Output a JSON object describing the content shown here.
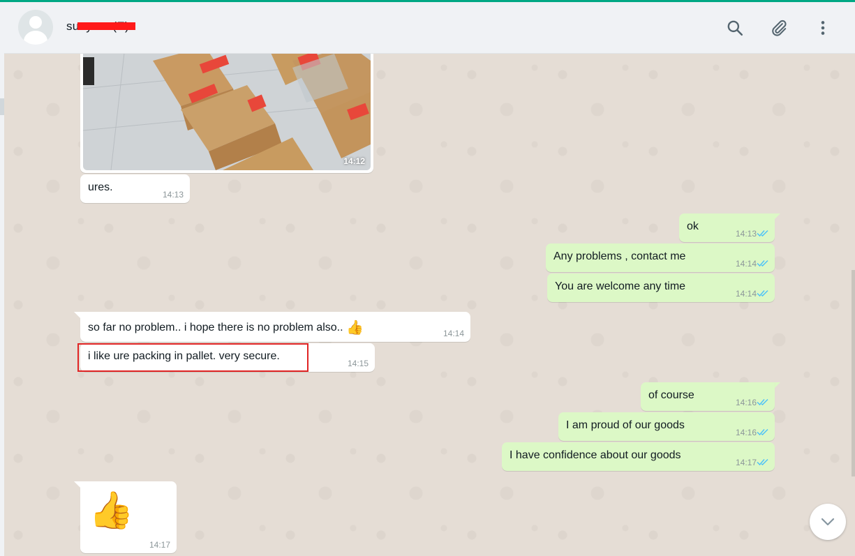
{
  "header": {
    "contact_name": "sunyuan(E)",
    "icons": [
      "search-icon",
      "attach-icon",
      "menu-icon"
    ]
  },
  "colors": {
    "incoming_bubble": "#ffffff",
    "outgoing_bubble": "#dcf8c6",
    "read_ticks": "#4fc3f7",
    "chat_background": "#e5ddd5",
    "highlight_box": "#e02424"
  },
  "messages": [
    {
      "dir": "in",
      "type": "image",
      "time": "14:12"
    },
    {
      "dir": "in",
      "text": "ures.",
      "time": "14:13"
    },
    {
      "dir": "out",
      "text": "ok",
      "time": "14:13",
      "status": "read"
    },
    {
      "dir": "out",
      "text": "Any problems , contact me",
      "time": "14:14",
      "status": "read"
    },
    {
      "dir": "out",
      "text": "You are welcome any time",
      "time": "14:14",
      "status": "read"
    },
    {
      "dir": "in",
      "text": "so far no problem.. i hope there is no problem also..",
      "emoji": "👍",
      "time": "14:14"
    },
    {
      "dir": "in",
      "text": "i like ure packing in pallet. very secure.",
      "time": "14:15",
      "highlighted": true
    },
    {
      "dir": "out",
      "text": "of course",
      "time": "14:16",
      "status": "read"
    },
    {
      "dir": "out",
      "text": "I am proud of our goods",
      "time": "14:16",
      "status": "read"
    },
    {
      "dir": "out",
      "text": "I have confidence about our goods",
      "time": "14:17",
      "status": "read"
    },
    {
      "dir": "in",
      "emoji": "👍",
      "time": "14:17"
    }
  ]
}
